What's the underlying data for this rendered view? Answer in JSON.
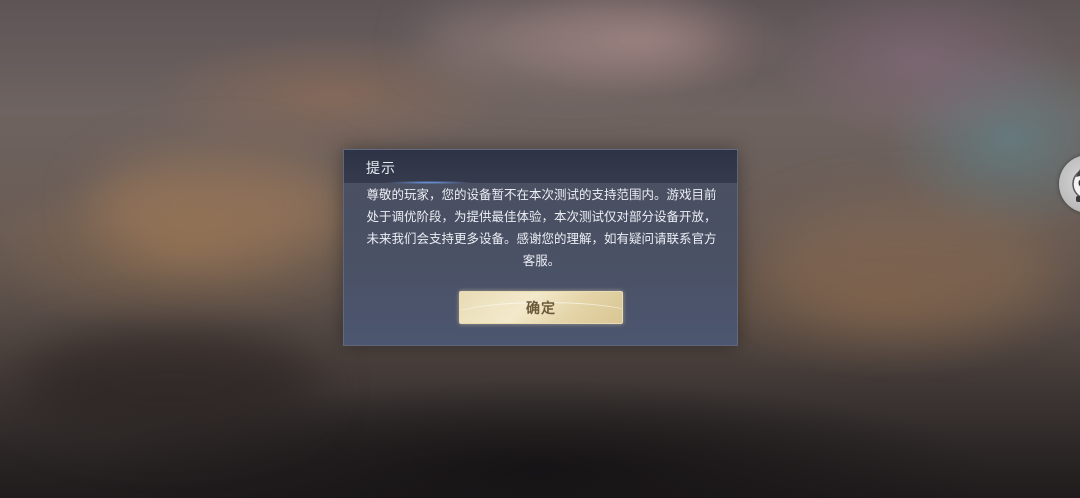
{
  "dialog": {
    "title": "提示",
    "message": "尊敬的玩家，您的设备暂不在本次测试的支持范围内。游戏目前处于调优阶段，为提供最佳体验，本次测试仅对部分设备开放，未来我们会支持更多设备。感谢您的理解，如有疑问请联系官方客服。",
    "confirm_label": "确定"
  },
  "floating_button": {
    "icon": "mascot-avatar-icon"
  },
  "colors": {
    "dialog_bg": "#4b5165",
    "header_bg": "#2e3346",
    "button_gold": "#e9dcb6",
    "button_text": "#6b5a3a"
  }
}
